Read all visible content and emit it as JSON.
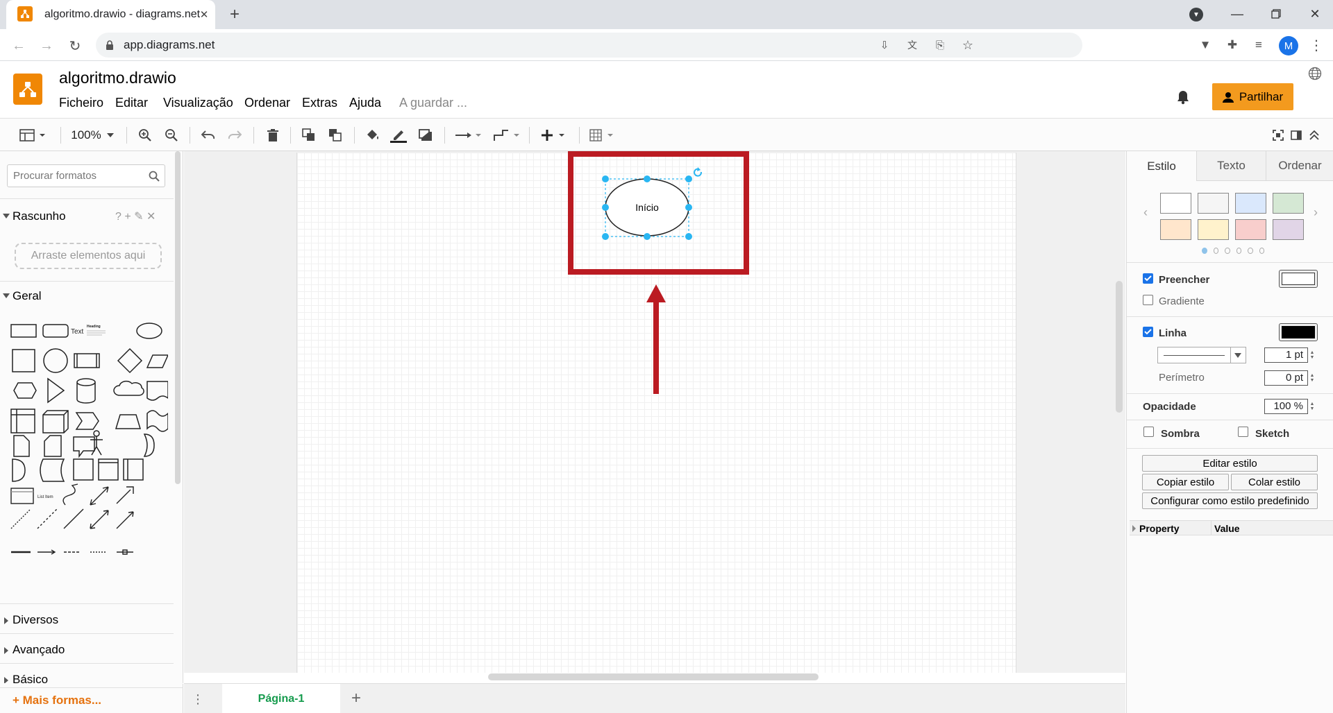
{
  "browser": {
    "tab_title": "algoritmo.drawio - diagrams.net",
    "url": "app.diagrams.net",
    "profile_initial": "M"
  },
  "app": {
    "file_title": "algoritmo.drawio",
    "menus": [
      "Ficheiro",
      "Editar",
      "Visualização",
      "Ordenar",
      "Extras",
      "Ajuda"
    ],
    "save_status": "A guardar ...",
    "share_label": "Partilhar",
    "accent": "#f39a1e"
  },
  "toolbar": {
    "zoom": "100%"
  },
  "sidebar": {
    "search_placeholder": "Procurar formatos",
    "scratchpad_title": "Rascunho",
    "scratchpad_icons": "? + ✎ ✕",
    "drop_hint": "Arraste elementos aqui",
    "general_title": "Geral",
    "shape_text_label": "Text",
    "shape_heading_label": "Heading",
    "shape_listitem_label": "List Item",
    "collapsed_sections": [
      "Diversos",
      "Avançado",
      "Básico"
    ],
    "more_shapes": "+ Mais formas..."
  },
  "diagram": {
    "shape_label": "Início",
    "highlight_color": "#bb1b22"
  },
  "pages": {
    "active": "Página-1"
  },
  "format_panel": {
    "tabs": [
      "Estilo",
      "Texto",
      "Ordenar"
    ],
    "swatch_colors": [
      "#ffffff",
      "#f5f5f5",
      "#dae8fc",
      "#d5e8d4",
      "#ffe6cc",
      "#fff2cc",
      "#f8cecc",
      "#e1d5e7"
    ],
    "fill_label": "Preencher",
    "gradient_label": "Gradiente",
    "line_label": "Linha",
    "line_width": "1 pt",
    "perimeter_label": "Perímetro",
    "perimeter_value": "0 pt",
    "opacity_label": "Opacidade",
    "opacity_value": "100 %",
    "shadow_label": "Sombra",
    "sketch_label": "Sketch",
    "edit_style": "Editar estilo",
    "copy_style": "Copiar estilo",
    "paste_style": "Colar estilo",
    "set_default_style": "Configurar como estilo predefinido",
    "prop_header": "Property",
    "value_header": "Value"
  }
}
